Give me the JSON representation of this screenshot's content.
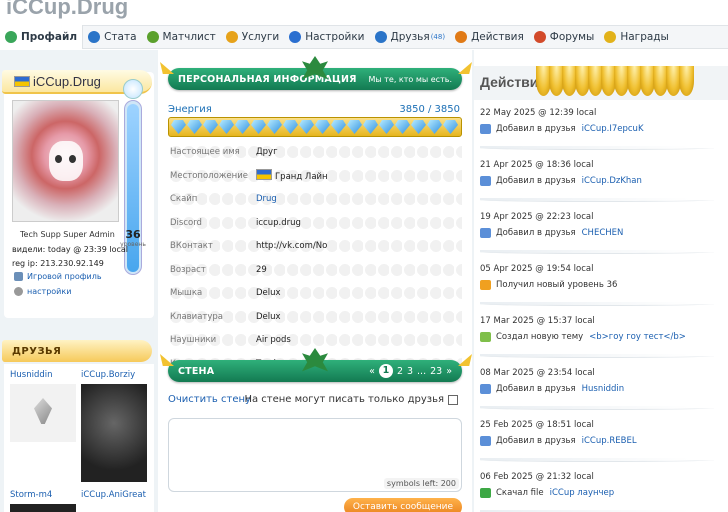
{
  "app": {
    "title": "iCCup.Drug"
  },
  "nav": {
    "items": [
      {
        "label": "Профайл",
        "icon": "profile-icon",
        "color": "#3aa65a"
      },
      {
        "label": "Стата",
        "icon": "stats-icon",
        "color": "#2a74c8"
      },
      {
        "label": "Матчлист",
        "icon": "matchlist-icon",
        "color": "#5aa02c"
      },
      {
        "label": "Услуги",
        "icon": "services-icon",
        "color": "#e6a21a"
      },
      {
        "label": "Настройки",
        "icon": "settings-icon",
        "color": "#2a6fd0"
      },
      {
        "label": "Друзья",
        "icon": "friends-icon",
        "color": "#2a74c8",
        "badge": "(48)"
      },
      {
        "label": "Действия",
        "icon": "actions-icon",
        "color": "#e07a16"
      },
      {
        "label": "Форумы",
        "icon": "forums-icon",
        "color": "#d24a2a"
      },
      {
        "label": "Награды",
        "icon": "awards-icon",
        "color": "#e2b21a"
      }
    ]
  },
  "profile": {
    "username": "iCCup.Drug",
    "role": "Tech Supp Super Admin",
    "level": "36",
    "level_label": "уровень",
    "seen": "видели: today @ 23:39 local",
    "reg_ip": "reg ip: 213.230.92.149",
    "links": [
      {
        "label": "Игровой профиль",
        "icon": "game-profile-icon"
      },
      {
        "label": "настройки",
        "icon": "settings-gear-icon"
      }
    ],
    "energy_fill": 1.0
  },
  "friends": {
    "title": "ДРУЗЬЯ",
    "items": [
      {
        "name": "Husniddin"
      },
      {
        "name": "iCCup.Borziy"
      },
      {
        "name": "Storm-m4"
      },
      {
        "name": "iCCup.AniGreat"
      }
    ]
  },
  "personal": {
    "title": "ПЕРСОНАЛЬНАЯ ИНФОРМАЦИЯ",
    "subtitle": "Мы те, кто мы есть.",
    "energy_label": "Энергия",
    "energy_value": "3850 / 3850",
    "gem_count": 18,
    "rows": [
      {
        "key": "Настоящее имя",
        "value": "Друг"
      },
      {
        "key": "Местоположение",
        "value": "Гранд Лайн",
        "flag": true
      },
      {
        "key": "Скайп",
        "value": "Drug",
        "link": true
      },
      {
        "key": "Discord",
        "value": "iccup.drug"
      },
      {
        "key": "ВКонтакт",
        "value": "http://vk.com/No"
      },
      {
        "key": "Возраст",
        "value": "29"
      },
      {
        "key": "Мышка",
        "value": "Delux"
      },
      {
        "key": "Клавиатура",
        "value": "Delux"
      },
      {
        "key": "Наушники",
        "value": "Air pods"
      },
      {
        "key": "Коврик",
        "value": "Travka"
      }
    ]
  },
  "wall": {
    "title": "СТЕНА",
    "pages": {
      "prev": "«",
      "current": "1",
      "p2": "2",
      "p3": "3",
      "dots": "...",
      "last": "23",
      "next": "»"
    },
    "clear": "Очистить стену",
    "only_friends": "На стене могут писать только друзья",
    "symbols_left": "symbols left: 200",
    "send": "Оставить сообщение"
  },
  "activity": {
    "title": "Действия",
    "items": [
      {
        "date": "22 May 2025 @ 12:39 local",
        "icon": "add-friend-icon",
        "text": "Добавил в друзья",
        "link": "iCCup.I7epcuK"
      },
      {
        "date": "21 Apr 2025 @ 18:36 local",
        "icon": "add-friend-icon",
        "text": "Добавил в друзья",
        "link": "iCCup.DzKhan"
      },
      {
        "date": "19 Apr 2025 @ 22:23 local",
        "icon": "add-friend-icon",
        "text": "Добавил в друзья",
        "link": "CHECHEN"
      },
      {
        "date": "05 Apr 2025 @ 19:54 local",
        "icon": "level-up-icon",
        "text": "Получил новый уровень 36",
        "link": ""
      },
      {
        "date": "17 Mar 2025 @ 15:37 local",
        "icon": "new-topic-icon",
        "text": "Создал новую тему",
        "link": "<b>гоу гоу тест</b>"
      },
      {
        "date": "08 Mar 2025 @ 23:54 local",
        "icon": "add-friend-icon",
        "text": "Добавил в друзья",
        "link": "Husniddin"
      },
      {
        "date": "25 Feb 2025 @ 18:51 local",
        "icon": "add-friend-icon",
        "text": "Добавил в друзья",
        "link": "iCCup.REBEL"
      },
      {
        "date": "06 Feb 2025 @ 21:32 local",
        "icon": "download-icon",
        "text": "Скачал file",
        "link": "iCCup лаунчер"
      }
    ]
  }
}
